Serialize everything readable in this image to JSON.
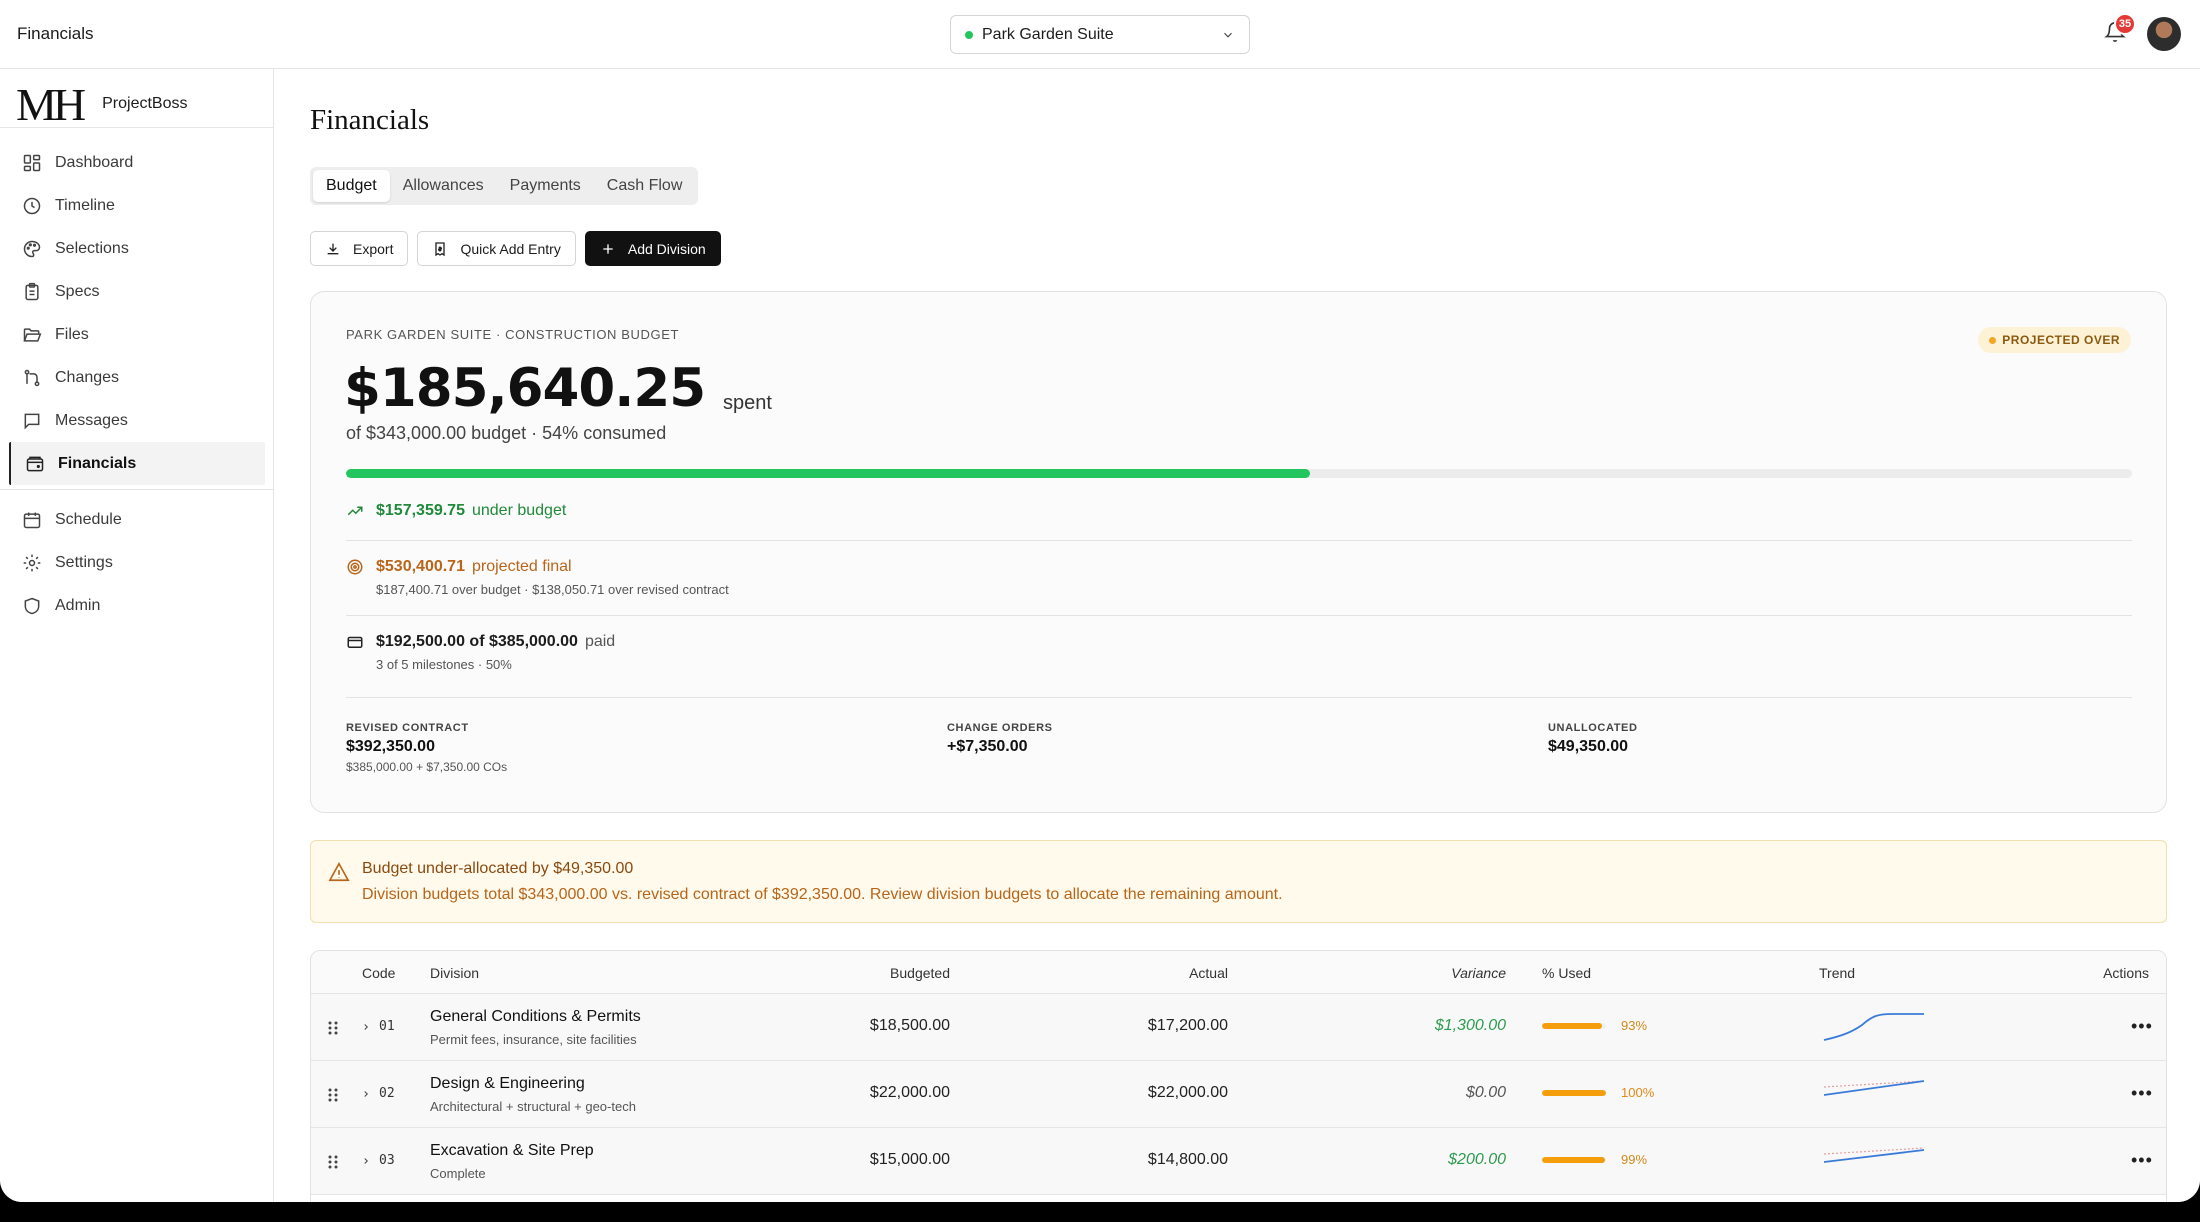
{
  "topbar": {
    "title": "Financials",
    "project": "Park Garden Suite",
    "notifications": "35"
  },
  "brand": {
    "logo": "MH",
    "name": "ProjectBoss"
  },
  "nav": {
    "items": [
      {
        "label": "Dashboard",
        "icon": "dashboard-icon"
      },
      {
        "label": "Timeline",
        "icon": "clock-icon"
      },
      {
        "label": "Selections",
        "icon": "palette-icon"
      },
      {
        "label": "Specs",
        "icon": "clipboard-icon"
      },
      {
        "label": "Files",
        "icon": "folder-icon"
      },
      {
        "label": "Changes",
        "icon": "git-branch-icon"
      },
      {
        "label": "Messages",
        "icon": "message-icon"
      },
      {
        "label": "Financials",
        "icon": "wallet-icon",
        "active": true
      }
    ],
    "secondary": [
      {
        "label": "Schedule",
        "icon": "calendar-icon"
      },
      {
        "label": "Settings",
        "icon": "gear-icon"
      },
      {
        "label": "Admin",
        "icon": "shield-icon"
      }
    ]
  },
  "page": {
    "title": "Financials"
  },
  "tabs": [
    "Budget",
    "Allowances",
    "Payments",
    "Cash Flow"
  ],
  "actions": {
    "export": "Export",
    "quick_add": "Quick Add Entry",
    "add_division": "Add Division"
  },
  "summary": {
    "eyebrow": "PARK GARDEN SUITE · CONSTRUCTION BUDGET",
    "status": "PROJECTED OVER",
    "spent": "$185,640.25",
    "spent_suffix": "spent",
    "subtitle": "of $343,000.00 budget · 54% consumed",
    "progress": 0.54,
    "under_amount": "$157,359.75",
    "under_label": "under budget",
    "projected_amount": "$530,400.71",
    "projected_label": "projected final",
    "projected_note": "$187,400.71 over budget · $138,050.71 over revised contract",
    "paid_amount": "$192,500.00 of $385,000.00",
    "paid_label": "paid",
    "paid_note": "3 of 5 milestones · 50%",
    "revised_label": "REVISED CONTRACT",
    "revised_value": "$392,350.00",
    "revised_note": "$385,000.00 + $7,350.00 COs",
    "co_label": "CHANGE ORDERS",
    "co_value": "+$7,350.00",
    "unalloc_label": "UNALLOCATED",
    "unalloc_value": "$49,350.00"
  },
  "alert": {
    "title": "Budget under-allocated by $49,350.00",
    "detail": "Division budgets total $343,000.00 vs. revised contract of $392,350.00. Review division budgets to allocate the remaining amount."
  },
  "table": {
    "headers": {
      "code": "Code",
      "division": "Division",
      "budgeted": "Budgeted",
      "actual": "Actual",
      "variance": "Variance",
      "used": "% Used",
      "trend": "Trend",
      "actions": "Actions"
    },
    "rows": [
      {
        "code": "01",
        "name": "General Conditions & Permits",
        "desc": "Permit fees, insurance, site facilities",
        "budgeted": "$18,500.00",
        "actual": "$17,200.00",
        "variance": "$1,300.00",
        "used": "93%",
        "used_frac": 0.93,
        "variance_color": "#2e9b4f",
        "used_color": "#d08a1a"
      },
      {
        "code": "02",
        "name": "Design & Engineering",
        "desc": "Architectural + structural + geo-tech",
        "budgeted": "$22,000.00",
        "actual": "$22,000.00",
        "variance": "$0.00",
        "used": "100%",
        "used_frac": 1.0,
        "variance_color": "#555555",
        "used_color": "#e08a1a"
      },
      {
        "code": "03",
        "name": "Excavation & Site Prep",
        "desc": "Complete",
        "budgeted": "$15,000.00",
        "actual": "$14,800.00",
        "variance": "$200.00",
        "used": "99%",
        "used_frac": 0.99,
        "variance_color": "#2e9b4f",
        "used_color": "#d08a1a"
      }
    ]
  }
}
